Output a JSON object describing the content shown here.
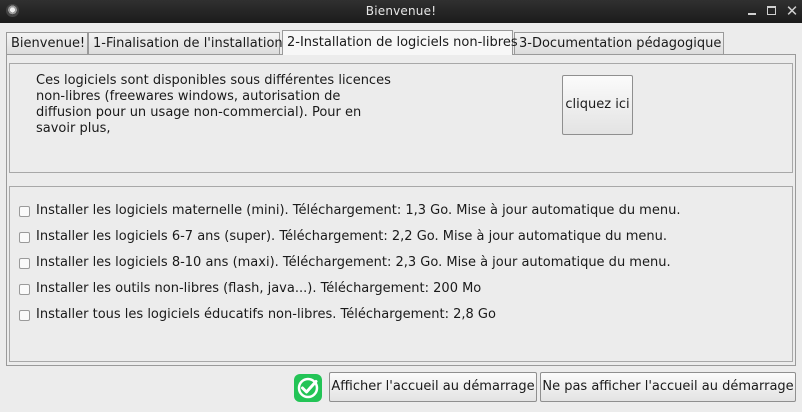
{
  "window": {
    "title": "Bienvenue!",
    "icons": [
      "app-icon",
      "minimize-icon",
      "maximize-icon",
      "close-icon"
    ]
  },
  "tabs": [
    {
      "label": "Bienvenue!",
      "active": false
    },
    {
      "label": "1-Finalisation de l'installation",
      "active": false
    },
    {
      "label": "2-Installation de logiciels non-libres",
      "active": true
    },
    {
      "label": "3-Documentation pédagogique",
      "active": false
    }
  ],
  "info": {
    "text": "Ces logiciels sont disponibles sous différentes licences non-libres (freewares windows, autorisation de diffusion pour un usage non-commercial). Pour en savoir plus,",
    "button_label": "cliquez ici"
  },
  "options": [
    {
      "label": "Installer les logiciels maternelle (mini). Téléchargement: 1,3 Go. Mise à jour automatique du menu.",
      "checked": false
    },
    {
      "label": "Installer les logiciels 6-7 ans (super). Téléchargement: 2,2 Go. Mise à jour automatique du menu.",
      "checked": false
    },
    {
      "label": "Installer les logiciels 8-10 ans (maxi). Téléchargement: 2,3 Go. Mise à jour automatique du menu.",
      "checked": false
    },
    {
      "label": "Installer les outils non-libres (flash, java...). Téléchargement: 200 Mo",
      "checked": false
    },
    {
      "label": "Installer tous les logiciels éducatifs non-libres. Téléchargement: 2,8 Go",
      "checked": false
    }
  ],
  "footer": {
    "show_label": "Afficher l'accueil au démarrage",
    "noshow_label": "Ne pas afficher l'accueil au démarrage",
    "status_icon": "checkmark-icon",
    "accent_color": "#23c456"
  }
}
